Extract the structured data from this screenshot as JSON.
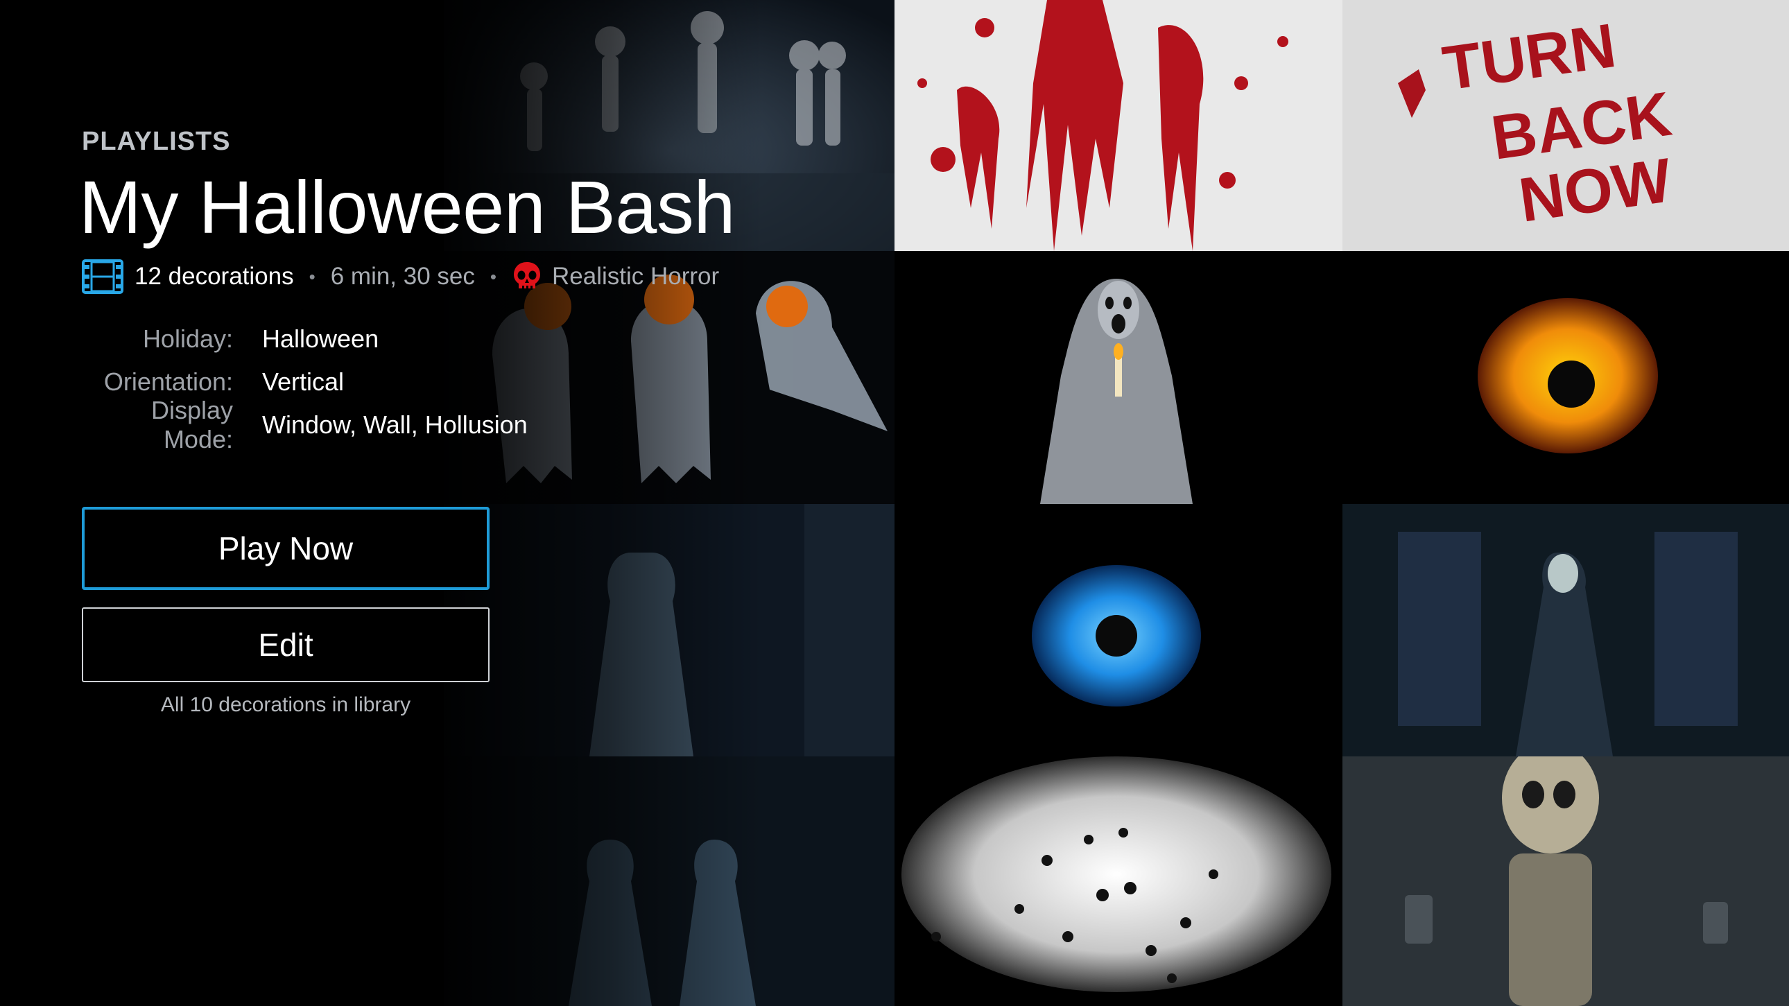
{
  "header": {
    "section_label": "PLAYLISTS",
    "title": "My Halloween Bash"
  },
  "meta": {
    "film_icon": "film-strip-icon",
    "decorations": "12 decorations",
    "separator": "•",
    "duration": "6 min, 30 sec",
    "rating_icon": "skull-icon",
    "rating": "Realistic Horror"
  },
  "details": [
    {
      "label": "Holiday:",
      "value": "Halloween"
    },
    {
      "label": "Orientation:",
      "value": "Vertical"
    },
    {
      "label": "Display Mode:",
      "value": "Window, Wall, Hollusion"
    }
  ],
  "actions": {
    "play_label": "Play Now",
    "edit_label": "Edit",
    "library_note": "All 10 decorations in library"
  },
  "background_tiles": [
    {
      "name": "dancing-skeletons-thumbnail"
    },
    {
      "name": "blood-splatter-thumbnail"
    },
    {
      "name": "turn-back-now-thumbnail",
      "text": "TURN BACK NOW"
    },
    {
      "name": "pumpkin-ghosts-thumbnail"
    },
    {
      "name": "candle-ghost-thumbnail"
    },
    {
      "name": "yellow-eye-thumbnail"
    },
    {
      "name": "ghost-woman-thumbnail"
    },
    {
      "name": "blue-eye-thumbnail"
    },
    {
      "name": "ghost-man-thumbnail"
    },
    {
      "name": "ghost-children-thumbnail"
    },
    {
      "name": "spiders-thumbnail"
    },
    {
      "name": "skeleton-graveyard-thumbnail"
    }
  ],
  "colors": {
    "accent": "#1e9bd7",
    "skull": "#e0121a",
    "blood": "#b3121c"
  }
}
